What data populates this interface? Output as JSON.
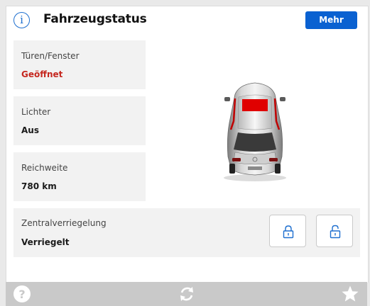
{
  "header": {
    "title": "Fahrzeugstatus",
    "info_icon": "info-circle-icon",
    "more_label": "Mehr"
  },
  "status": {
    "doors_windows": {
      "label": "Türen/Fenster",
      "value": "Geöffnet",
      "value_color": "#c5271f"
    },
    "lights": {
      "label": "Lichter",
      "value": "Aus"
    },
    "range": {
      "label": "Reichweite",
      "value": "780 km"
    },
    "central_locking": {
      "label": "Zentralverriegelung",
      "value": "Verriegelt",
      "buttons": [
        "lock-closed-icon",
        "lock-open-icon"
      ]
    }
  },
  "vehicle": {
    "open_area": "sunroof",
    "highlight_color": "#e00000"
  },
  "footer": {
    "icons": [
      "help-icon",
      "refresh-icon",
      "favorite-star-icon"
    ]
  },
  "colors": {
    "accent": "#0a61d1",
    "tile": "#f2f2f2",
    "footer": "#c9c9c9"
  }
}
